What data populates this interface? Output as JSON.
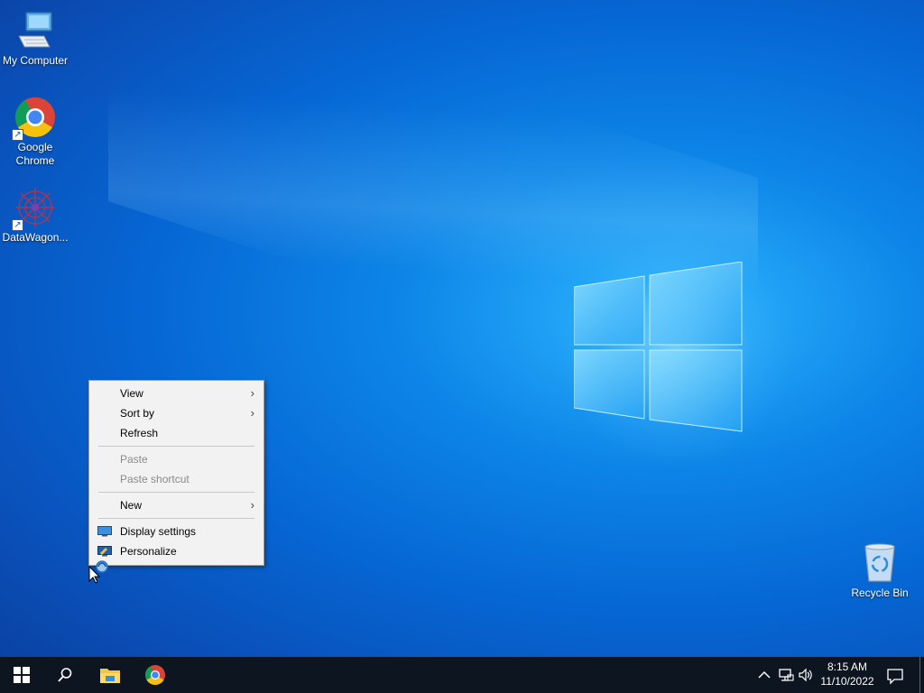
{
  "desktop_icons": [
    {
      "label": "My Computer",
      "icon": "computer-icon"
    },
    {
      "label": "Google Chrome",
      "icon": "chrome-icon",
      "label_line1": "Google",
      "label_line2": "Chrome"
    },
    {
      "label": "DataWagon...",
      "icon": "datawagon-icon"
    },
    {
      "label": "Recycle Bin",
      "icon": "recycle-bin-icon"
    }
  ],
  "context_menu": {
    "items": [
      {
        "label": "View",
        "submenu": true
      },
      {
        "label": "Sort by",
        "submenu": true
      },
      {
        "label": "Refresh"
      },
      {
        "label": "Paste",
        "disabled": true
      },
      {
        "label": "Paste shortcut",
        "disabled": true
      },
      {
        "label": "New",
        "submenu": true
      },
      {
        "label": "Display settings",
        "icon": "display-icon"
      },
      {
        "label": "Personalize",
        "icon": "personalize-icon"
      }
    ]
  },
  "taskbar": {
    "pinned": [
      "start-icon",
      "search-icon",
      "file-explorer-icon",
      "chrome-icon"
    ],
    "tray": [
      "chevron-up-icon",
      "network-icon",
      "volume-icon"
    ],
    "clock": {
      "time": "8:15 AM",
      "date": "11/10/2022"
    }
  },
  "colors": {
    "accent": "#0a78e0",
    "taskbar": "#0d1520",
    "menu_bg": "#f2f2f2"
  }
}
